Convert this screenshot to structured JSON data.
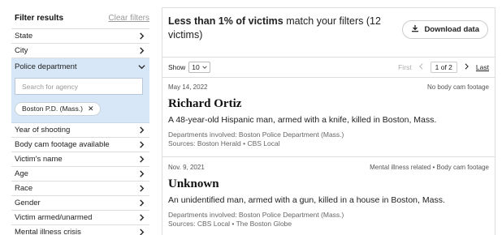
{
  "sidebar": {
    "title": "Filter results",
    "clear": "Clear filters",
    "items_top": [
      {
        "label": "State"
      },
      {
        "label": "City"
      }
    ],
    "expanded": {
      "label": "Police department",
      "search_placeholder": "Search for agency",
      "chip": "Boston P.D. (Mass.)"
    },
    "items_bottom": [
      {
        "label": "Year of shooting"
      },
      {
        "label": "Body cam footage available"
      },
      {
        "label": "Victim's name"
      },
      {
        "label": "Age"
      },
      {
        "label": "Race"
      },
      {
        "label": "Gender"
      },
      {
        "label": "Victim armed/unarmed"
      },
      {
        "label": "Mental illness crisis"
      }
    ]
  },
  "headline": {
    "strong": "Less than 1% of victims",
    "rest": " match your filters (12 victims)"
  },
  "download_label": "Download data",
  "pager": {
    "show_label": "Show",
    "page_size": "10",
    "first": "First",
    "page_of": "1 of 2",
    "last": "Last"
  },
  "records": [
    {
      "date": "May 14, 2022",
      "tag": "No body cam footage",
      "name": "Richard Ortiz",
      "desc": "A 48-year-old Hispanic man, armed with a knife, killed in Boston, Mass.",
      "departments": "Departments involved: Boston Police Department (Mass.)",
      "sources": "Sources: Boston Herald • CBS Local"
    },
    {
      "date": "Nov. 9, 2021",
      "tag": "Mental illness related • Body cam footage",
      "name": "Unknown",
      "desc": "An unidentified man, armed with a gun, killed in a house in Boston, Mass.",
      "departments": "Departments involved: Boston Police Department (Mass.)",
      "sources": "Sources: CBS Local • The Boston Globe"
    }
  ]
}
